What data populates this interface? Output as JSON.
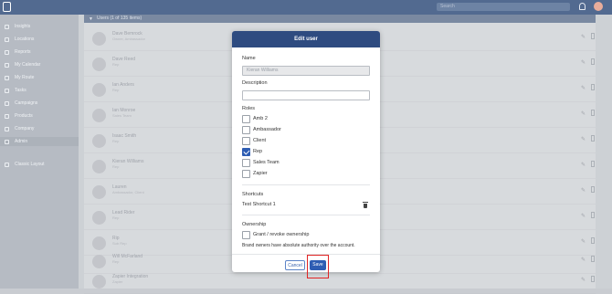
{
  "topbar": {
    "search_placeholder": "Search"
  },
  "sidebar": {
    "items": [
      {
        "label": "Insights",
        "active": false
      },
      {
        "label": "Locations",
        "active": false
      },
      {
        "label": "Reports",
        "active": false
      },
      {
        "label": "My Calendar",
        "active": false
      },
      {
        "label": "My Route",
        "active": false
      },
      {
        "label": "Tasks",
        "active": false
      },
      {
        "label": "Campaigns",
        "active": false
      },
      {
        "label": "Products",
        "active": false
      },
      {
        "label": "Company",
        "active": false
      },
      {
        "label": "Admin",
        "active": true
      }
    ],
    "footer": "Classic Layout"
  },
  "users_panel": {
    "header": "Users (1 of 135 items)",
    "rows": [
      {
        "name": "Dave Bemrock",
        "sub": "Owner, Ambassador"
      },
      {
        "name": "Dave Reed",
        "sub": "Rep"
      },
      {
        "name": "Ian Anders",
        "sub": "Rep"
      },
      {
        "name": "Ian Monroe",
        "sub": "Sales Team"
      },
      {
        "name": "Isaac Smith",
        "sub": "Rep"
      },
      {
        "name": "Kieran Williams",
        "sub": "Rep"
      },
      {
        "name": "Lauren",
        "sub": "Ambassador, Client"
      },
      {
        "name": "Lead Rider",
        "sub": "Rep"
      },
      {
        "name": "Rip",
        "sub": "Sub Rep"
      },
      {
        "name": "Will McFarland",
        "sub": "Rep"
      },
      {
        "name": "Zapier Integration",
        "sub": "Zapier"
      }
    ]
  },
  "modal": {
    "title": "Edit user",
    "name_label": "Name",
    "name_value": "Kieran Williams",
    "description_label": "Description",
    "description_value": "",
    "roles_label": "Roles",
    "roles": [
      {
        "label": "Amb 2",
        "checked": false
      },
      {
        "label": "Ambassador",
        "checked": false
      },
      {
        "label": "Client",
        "checked": false
      },
      {
        "label": "Rep",
        "checked": true
      },
      {
        "label": "Sales Team",
        "checked": false
      },
      {
        "label": "Zapier",
        "checked": false
      }
    ],
    "shortcuts_label": "Shortcuts",
    "shortcut_name": "Test Shortcut 1",
    "ownership_label": "Ownership",
    "ownership_checkbox_label": "Grant / revoke ownership",
    "ownership_note": "Brand owners have absolute authority over the account.",
    "cancel_label": "Cancel",
    "save_label": "Save"
  },
  "colors": {
    "accent": "#2e4b80",
    "primary_button": "#2e5db3",
    "highlight": "#e02424"
  }
}
